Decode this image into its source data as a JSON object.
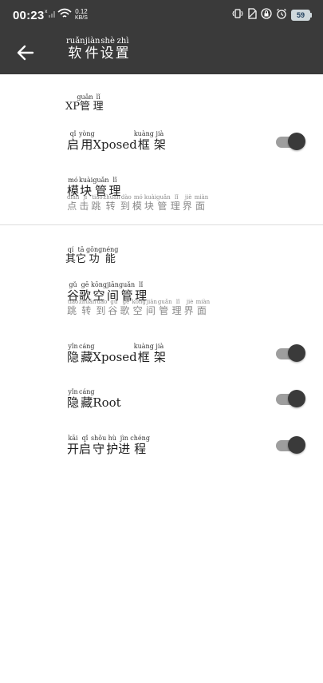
{
  "status_bar": {
    "time": "00:23",
    "net_speed_value": "0.12",
    "net_speed_unit": "KB/S",
    "battery": "59",
    "icons": [
      "x-badge-icon",
      "signal-icon",
      "wifi-icon",
      "vibrate-icon",
      "sim-icon",
      "lock-icon",
      "alarm-icon",
      "battery-icon"
    ]
  },
  "app_bar": {
    "back_icon": "arrow-left-icon",
    "title": [
      {
        "char": "软",
        "py": "ruǎn"
      },
      {
        "char": "件",
        "py": "jiàn"
      },
      {
        "char": "设",
        "py": "shè"
      },
      {
        "char": "置",
        "py": "zhì"
      }
    ]
  },
  "sections": {
    "xp": {
      "header": {
        "prefix": "XP",
        "chars": [
          {
            "char": "管",
            "py": "guǎn"
          },
          {
            "char": "理",
            "py": "lǐ"
          }
        ]
      },
      "enable_xposed": {
        "pre": [
          {
            "char": "启",
            "py": "qǐ"
          },
          {
            "char": "用",
            "py": "yòng"
          }
        ],
        "mid": "Xposed",
        "post": [
          {
            "char": "框",
            "py": "kuàng"
          },
          {
            "char": "架",
            "py": "jià"
          }
        ],
        "enabled": true
      },
      "module_manage": {
        "title": [
          {
            "char": "模",
            "py": "mó"
          },
          {
            "char": "块",
            "py": "kuài"
          },
          {
            "char": "管",
            "py": "guǎn"
          },
          {
            "char": "理",
            "py": "lǐ"
          }
        ],
        "subtitle": [
          {
            "char": "点",
            "py": "diǎn"
          },
          {
            "char": "击",
            "py": "jī"
          },
          {
            "char": "跳",
            "py": "tiào"
          },
          {
            "char": "转",
            "py": "zhuǎn"
          },
          {
            "char": "到",
            "py": "dào"
          },
          {
            "char": "模",
            "py": "mó"
          },
          {
            "char": "块",
            "py": "kuài"
          },
          {
            "char": "管",
            "py": "guǎn"
          },
          {
            "char": "理",
            "py": "lǐ"
          },
          {
            "char": "界",
            "py": "jiè"
          },
          {
            "char": "面",
            "py": "miàn"
          }
        ]
      }
    },
    "other": {
      "header": [
        {
          "char": "其",
          "py": "qí"
        },
        {
          "char": "它",
          "py": "tā"
        },
        {
          "char": "功",
          "py": "gōng"
        },
        {
          "char": "能",
          "py": "néng"
        }
      ],
      "space_manage": {
        "title": [
          {
            "char": "谷",
            "py": "gǔ"
          },
          {
            "char": "歌",
            "py": "gē"
          },
          {
            "char": "空",
            "py": "kōng"
          },
          {
            "char": "间",
            "py": "jiān"
          },
          {
            "char": "管",
            "py": "guǎn"
          },
          {
            "char": "理",
            "py": "lǐ"
          }
        ],
        "subtitle": [
          {
            "char": "跳",
            "py": "tiào"
          },
          {
            "char": "转",
            "py": "zhuǎn"
          },
          {
            "char": "到",
            "py": "dào"
          },
          {
            "char": "谷",
            "py": "gǔ"
          },
          {
            "char": "歌",
            "py": "gē"
          },
          {
            "char": "空",
            "py": "kōng"
          },
          {
            "char": "间",
            "py": "jiān"
          },
          {
            "char": "管",
            "py": "guǎn"
          },
          {
            "char": "理",
            "py": "lǐ"
          },
          {
            "char": "界",
            "py": "jiè"
          },
          {
            "char": "面",
            "py": "miàn"
          }
        ]
      },
      "hide_xposed": {
        "pre": [
          {
            "char": "隐",
            "py": "yǐn"
          },
          {
            "char": "藏",
            "py": "cáng"
          }
        ],
        "mid": "Xposed",
        "post": [
          {
            "char": "框",
            "py": "kuàng"
          },
          {
            "char": "架",
            "py": "jià"
          }
        ],
        "enabled": true
      },
      "hide_root": {
        "pre": [
          {
            "char": "隐",
            "py": "yǐn"
          },
          {
            "char": "藏",
            "py": "cáng"
          }
        ],
        "mid": "Root",
        "enabled": true
      },
      "daemon": {
        "title": [
          {
            "char": "开",
            "py": "kāi"
          },
          {
            "char": "启",
            "py": "qǐ"
          },
          {
            "char": "守",
            "py": "shǒu"
          },
          {
            "char": "护",
            "py": "hù"
          },
          {
            "char": "进",
            "py": "jìn"
          },
          {
            "char": "程",
            "py": "chéng"
          }
        ],
        "enabled": true
      }
    }
  },
  "colors": {
    "app_bar": "#3a3a3a",
    "toggle_track": "#9e9e9e",
    "toggle_thumb": "#3a3a3a",
    "subtitle": "#8a8a8a"
  }
}
